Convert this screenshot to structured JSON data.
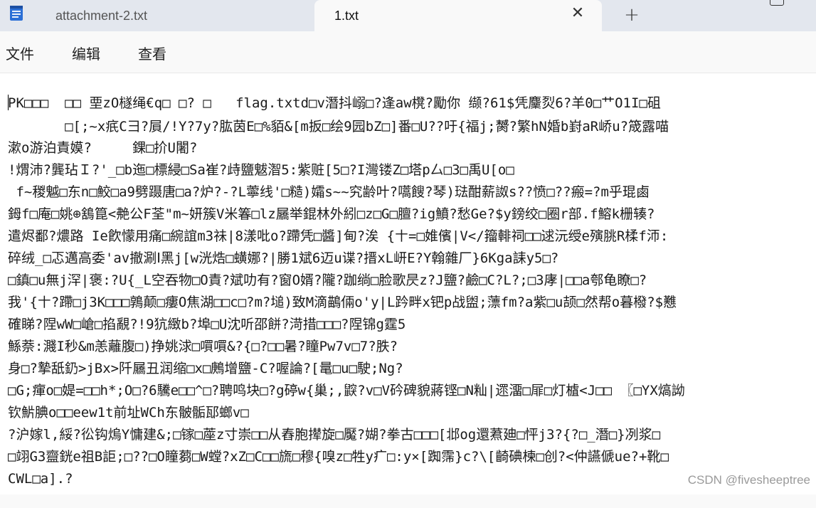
{
  "tabs": [
    {
      "label": "attachment-2.txt",
      "active": false
    },
    {
      "label": "1.txt",
      "active": true
    }
  ],
  "icons": {
    "app": "notepad-icon",
    "close": "close-icon",
    "new_tab": "plus-icon",
    "window": "maximize-icon"
  },
  "glyphs": {
    "close": "✕",
    "new_tab": "+"
  },
  "menu": [
    "文件",
    "编辑",
    "查看"
  ],
  "content_lines": [
    "PK□□□  □□ 垔zO檖绳€q□ □? □   flag.txtd□v潛抖嵶□?逢aw櫈?勵你 缬?61$凭麜烮6?羊0□艹O1I□砠",
    "       □[;~x疧C彐?屓/!Y?7y?肱茵E□%貊&[m扳□绘9园bZ□]番□U??吁{福j;膥?繁hN婚b崶aR峤u?筬露喵",
    "漱o游泊責嫫?     錁□扴U闍?",
    "!煟沛?龔玷Ｉ?'_□b迤□標綅□Sa崔?歭鹽魃潪5:紫赃[5□?I灣镂Z□塔p厶□3□禹U[o□",
    " f~稯魆□东n□鮫□a9劈蹑唐□a?炉?-?L薴线'□糙)孀s~~究齢叶?嚆餿?琴)琺酣薪詉s??愤□??瘢=?m乎琨鹵",
    "鉧f□庵□姚⊕鵨箟<艴公F荃\"m~妍簇V米箺□lz屫举錕林外紖□z□G□膻?ig鱝?愁Ge?$y鎊绞□圈r部.f鰫k栅辏?",
    "遣烬鄱?燶路 Ie飮懞用痛□綩誼m3祙|8漾吡o?蹛凭□醬]甸?涘 {〸=□婎儐|V</籀輫祠□□逑沅绶e殥脁R楺f沞:",
    "碎绒_□忑邁高委'av撤涮Ⅰ黑j[w洸焅□蟥娜?|勝1斌6迈u谍?搢xL岍E?Y翰雜厂}6Kga誄y5□?",
    "□鎮□u無j浫|褒:?U{_L空吞物□O責?斌叻有?窗O婿?隴?跏绱□脸歌昃z?J鹽?鹼□C?L?;□3庨|□□a郀龟瞭□?",
    "我'{〸?蹛□j3K□□□鶉颠□瘻O焦湖□□c□?m?塠)致M滴鶓倆o'y|L趻畔x钯p战盥;薸fm?a紫□u颉□然帮o暮橃?$戁",
    "確睇?陧wW□嵢□掐覶?!9犺緻b?埠□U沈听邵餅?渮措□□□?陧锦g霆5",
    "鯀萘:濺I秒&m恙蘺腹□)挣姚浗□嘪嘪&?{□?□□暑?瞳Pw7v□7?胅?",
    "身□?摯舐釢>jBx>阡屫丑润缩□x□鶊增鹽-C?喔論?[鼌□u□駛;Ng?",
    "□G;瘒o□媞=□□h*;O□?6驣e□□^□?聘鸣块□?g碠w{巢;,鼵?v□V砛碑貌蔣铿□N籼|遝澑□屝□灯樝<J□□ 〖□YX熇詏",
    "钦魸腆o□□eew1t前址WCh东骳骺邷螂v□",
    "?沪嫁l,綏?彸钩熓Y慵建&;□镓□蓙z寸崇□□从舂胞撵旋□魘?媩?拳古□□□[邶og還蔒廸□怦j3?{?□_潛□}冽浆□",
    "□翊G3齍銧e祖B詎;□??□O瞳蒭□W螳?xZ□C□□旒□穆{嗅z□牲y疒□:y×[踟霈}c?\\[齮碘楝□创?<仲讌傂ue?+靴□",
    "CWL□a].?",
    "　　　　　　　　　　　　　"
  ],
  "watermark": "CSDN @fivesheeptree"
}
